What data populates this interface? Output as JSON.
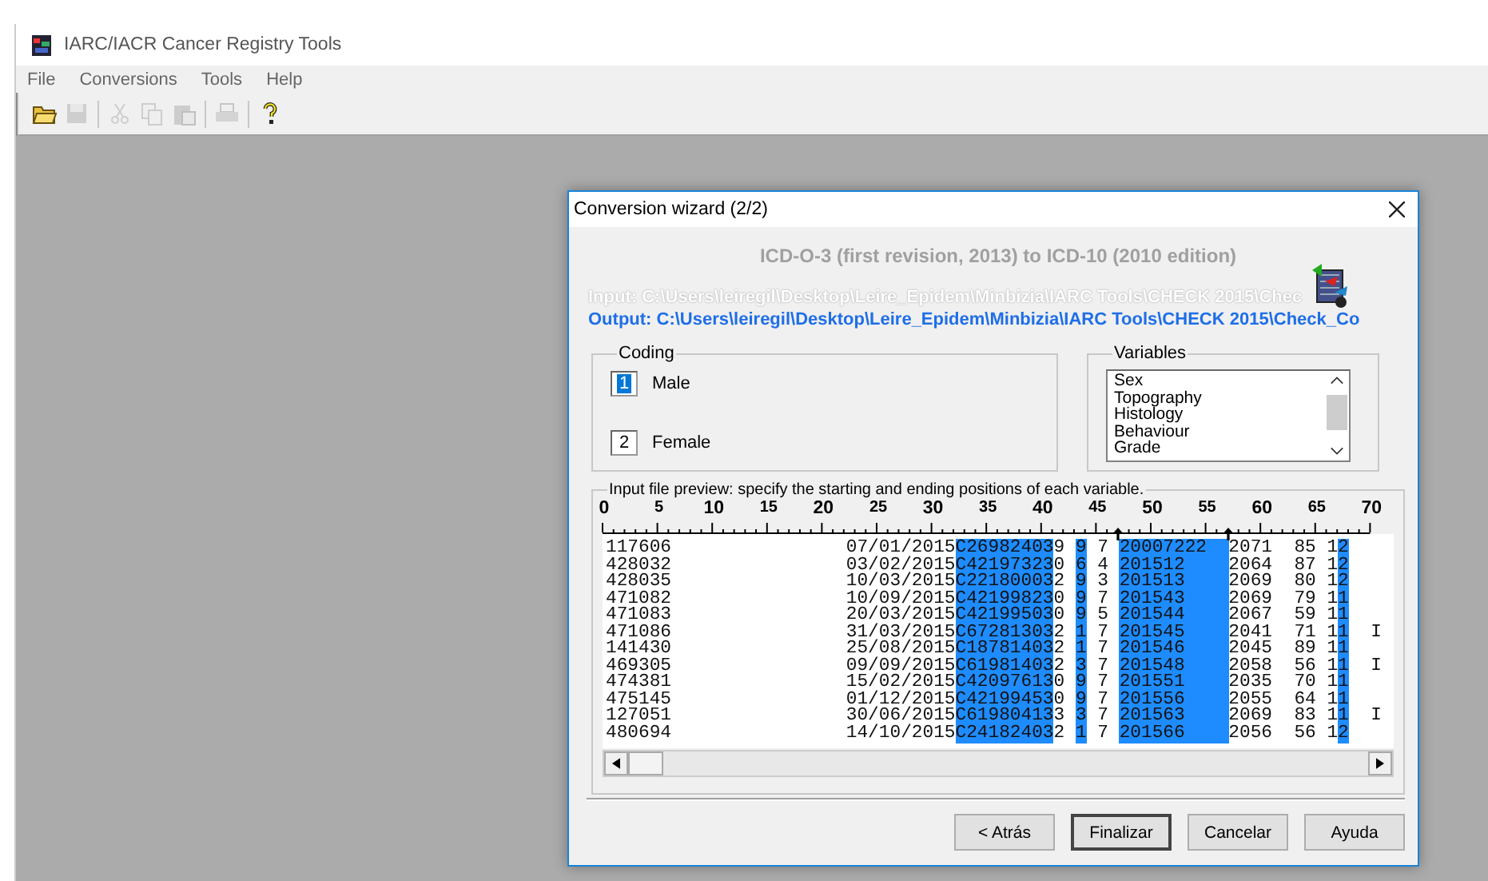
{
  "window": {
    "title": "IARC/IACR Cancer Registry Tools"
  },
  "menu": [
    "File",
    "Conversions",
    "Tools",
    "Help"
  ],
  "toolbar": [
    [
      {
        "kind": "open",
        "disabled": false
      },
      {
        "kind": "save",
        "disabled": true
      }
    ],
    [
      {
        "kind": "cut",
        "disabled": true
      },
      {
        "kind": "copy",
        "disabled": true
      },
      {
        "kind": "paste",
        "disabled": true
      }
    ],
    [
      {
        "kind": "print",
        "disabled": true
      }
    ],
    [
      {
        "kind": "help",
        "disabled": false
      }
    ]
  ],
  "dialog": {
    "title": "Conversion wizard (2/2)",
    "heading": "ICD-O-3 (first revision, 2013) to ICD-10 (2010 edition)",
    "input_path": "Input: C:\\Users\\leiregil\\Desktop\\Leire_Epidem\\Minbizia\\IARC Tools\\CHECK 2015\\Chec",
    "output_path": "Output: C:\\Users\\leiregil\\Desktop\\Leire_Epidem\\Minbizia\\IARC Tools\\CHECK 2015\\Check_Co",
    "coding": {
      "title": "Coding",
      "fields": [
        {
          "value": "1",
          "label": "Male",
          "selected": true
        },
        {
          "value": "2",
          "label": "Female",
          "selected": false
        }
      ]
    },
    "variables": {
      "title": "Variables",
      "items": [
        "Sex",
        "Topography",
        "Histology",
        "Behaviour",
        "Grade"
      ]
    },
    "preview": {
      "title": "Input file preview: specify the starting and ending positions of each variable.",
      "ruler": [
        "0",
        "5",
        "10",
        "15",
        "20",
        "25",
        "30",
        "35",
        "40",
        "45",
        "50",
        "55",
        "60",
        "65",
        "70"
      ],
      "columns": [
        {
          "highlighted": false,
          "marked": false
        },
        {
          "highlighted": false,
          "marked": false
        },
        {
          "highlighted": true,
          "marked": false
        },
        {
          "highlighted": false,
          "marked": false
        },
        {
          "highlighted": true,
          "marked": false
        },
        {
          "highlighted": false,
          "marked": false
        },
        {
          "highlighted": true,
          "marked": true
        },
        {
          "highlighted": false,
          "marked": false
        },
        {
          "highlighted": false,
          "marked": false
        },
        {
          "highlighted": false,
          "marked": false
        },
        {
          "highlighted": true,
          "marked": false
        },
        {
          "highlighted": false,
          "marked": false
        }
      ],
      "rows": [
        [
          "117606",
          "07/01/2015",
          "C26982403",
          "9",
          "9",
          "7",
          "20007222",
          "2071",
          "85",
          "1",
          "2"
        ],
        [
          "428032",
          "03/02/2015",
          "C42197323",
          "0",
          "6",
          "4",
          "201512",
          "2064",
          "87",
          "1",
          "2"
        ],
        [
          "428035",
          "10/03/2015",
          "C22180003",
          "2",
          "9",
          "3",
          "201513",
          "2069",
          "80",
          "1",
          "2"
        ],
        [
          "471082",
          "10/09/2015",
          "C42199823",
          "0",
          "9",
          "7",
          "201543",
          "2069",
          "79",
          "1",
          "1"
        ],
        [
          "471083",
          "20/03/2015",
          "C42199503",
          "0",
          "9",
          "5",
          "201544",
          "2067",
          "59",
          "1",
          "1"
        ],
        [
          "471086",
          "31/03/2015",
          "C67281303",
          "2",
          "1",
          "7",
          "201545",
          "2041",
          "71",
          "1",
          "1",
          "I"
        ],
        [
          "141430",
          "25/08/2015",
          "C18781403",
          "2",
          "1",
          "7",
          "201546",
          "2045",
          "89",
          "1",
          "1"
        ],
        [
          "469305",
          "09/09/2015",
          "C61981403",
          "2",
          "3",
          "7",
          "201548",
          "2058",
          "56",
          "1",
          "1",
          "I"
        ],
        [
          "474381",
          "15/02/2015",
          "C42097613",
          "0",
          "9",
          "7",
          "201551",
          "2035",
          "70",
          "1",
          "1"
        ],
        [
          "475145",
          "01/12/2015",
          "C42199453",
          "0",
          "9",
          "7",
          "201556",
          "2055",
          "64",
          "1",
          "1"
        ],
        [
          "127051",
          "30/06/2015",
          "C61980413",
          "3",
          "3",
          "7",
          "201563",
          "2069",
          "83",
          "1",
          "1",
          "I"
        ],
        [
          "480694",
          "14/10/2015",
          "C24182403",
          "2",
          "1",
          "7",
          "201566",
          "2056",
          "56",
          "1",
          "2"
        ]
      ]
    },
    "buttons": [
      {
        "label": "< Atrás",
        "default": false
      },
      {
        "label": "Finalizar",
        "default": true
      },
      {
        "label": "Cancelar",
        "default": false
      },
      {
        "label": "Ayuda",
        "default": false
      }
    ]
  }
}
